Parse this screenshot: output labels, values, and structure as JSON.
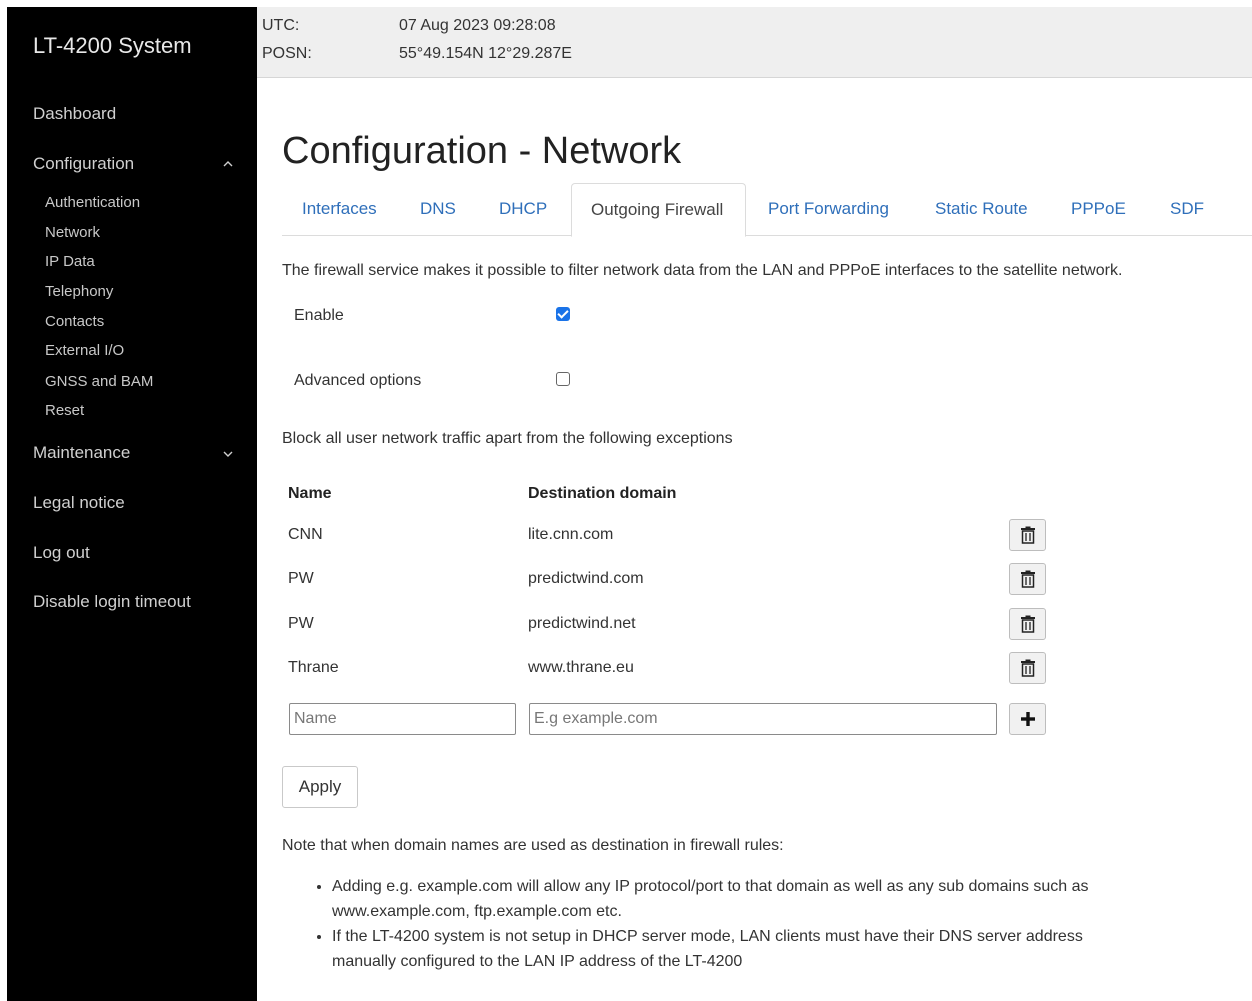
{
  "sidebar": {
    "brand": "LT-4200 System",
    "items": [
      {
        "label": "Dashboard"
      },
      {
        "label": "Configuration"
      },
      {
        "label": "Maintenance"
      },
      {
        "label": "Legal notice"
      },
      {
        "label": "Log out"
      },
      {
        "label": "Disable login timeout"
      }
    ],
    "config_sub": [
      "Authentication",
      "Network",
      "IP Data",
      "Telephony",
      "Contacts",
      "External I/O",
      "GNSS and BAM",
      "Reset"
    ]
  },
  "topbar": {
    "utc_label": "UTC:",
    "utc_value": "07 Aug 2023 09:28:08",
    "posn_label": "POSN:",
    "posn_value": "55°49.154N 12°29.287E"
  },
  "main": {
    "title": "Configuration - Network",
    "tabs": [
      {
        "label": "Interfaces"
      },
      {
        "label": "DNS"
      },
      {
        "label": "DHCP"
      },
      {
        "label": "Outgoing Firewall"
      },
      {
        "label": "Port Forwarding"
      },
      {
        "label": "Static Route"
      },
      {
        "label": "PPPoE"
      },
      {
        "label": "SDF"
      }
    ],
    "active_tab": "Outgoing Firewall",
    "description": "The firewall service makes it possible to filter network data from the LAN and PPPoE interfaces to the satellite network.",
    "enable_label": "Enable",
    "enable_checked": true,
    "advanced_label": "Advanced options",
    "advanced_checked": false,
    "block_text": "Block all user network traffic apart from the following exceptions",
    "table": {
      "headers": [
        "Name",
        "Destination domain"
      ],
      "rows": [
        {
          "name": "CNN",
          "domain": "lite.cnn.com"
        },
        {
          "name": "PW",
          "domain": "predictwind.com"
        },
        {
          "name": "PW",
          "domain": "predictwind.net"
        },
        {
          "name": "Thrane",
          "domain": "www.thrane.eu"
        }
      ]
    },
    "name_placeholder": "Name",
    "domain_placeholder": "E.g example.com",
    "apply_label": "Apply",
    "note_intro": "Note that when domain names are used as destination in firewall rules:",
    "notes": [
      "Adding e.g. example.com will allow any IP protocol/port to that domain as well as any sub domains such as www.example.com, ftp.example.com etc.",
      "If the LT-4200 system is not setup in DHCP server mode, LAN clients must have their DNS server address manually configured to the LAN IP address of the LT-4200"
    ]
  }
}
